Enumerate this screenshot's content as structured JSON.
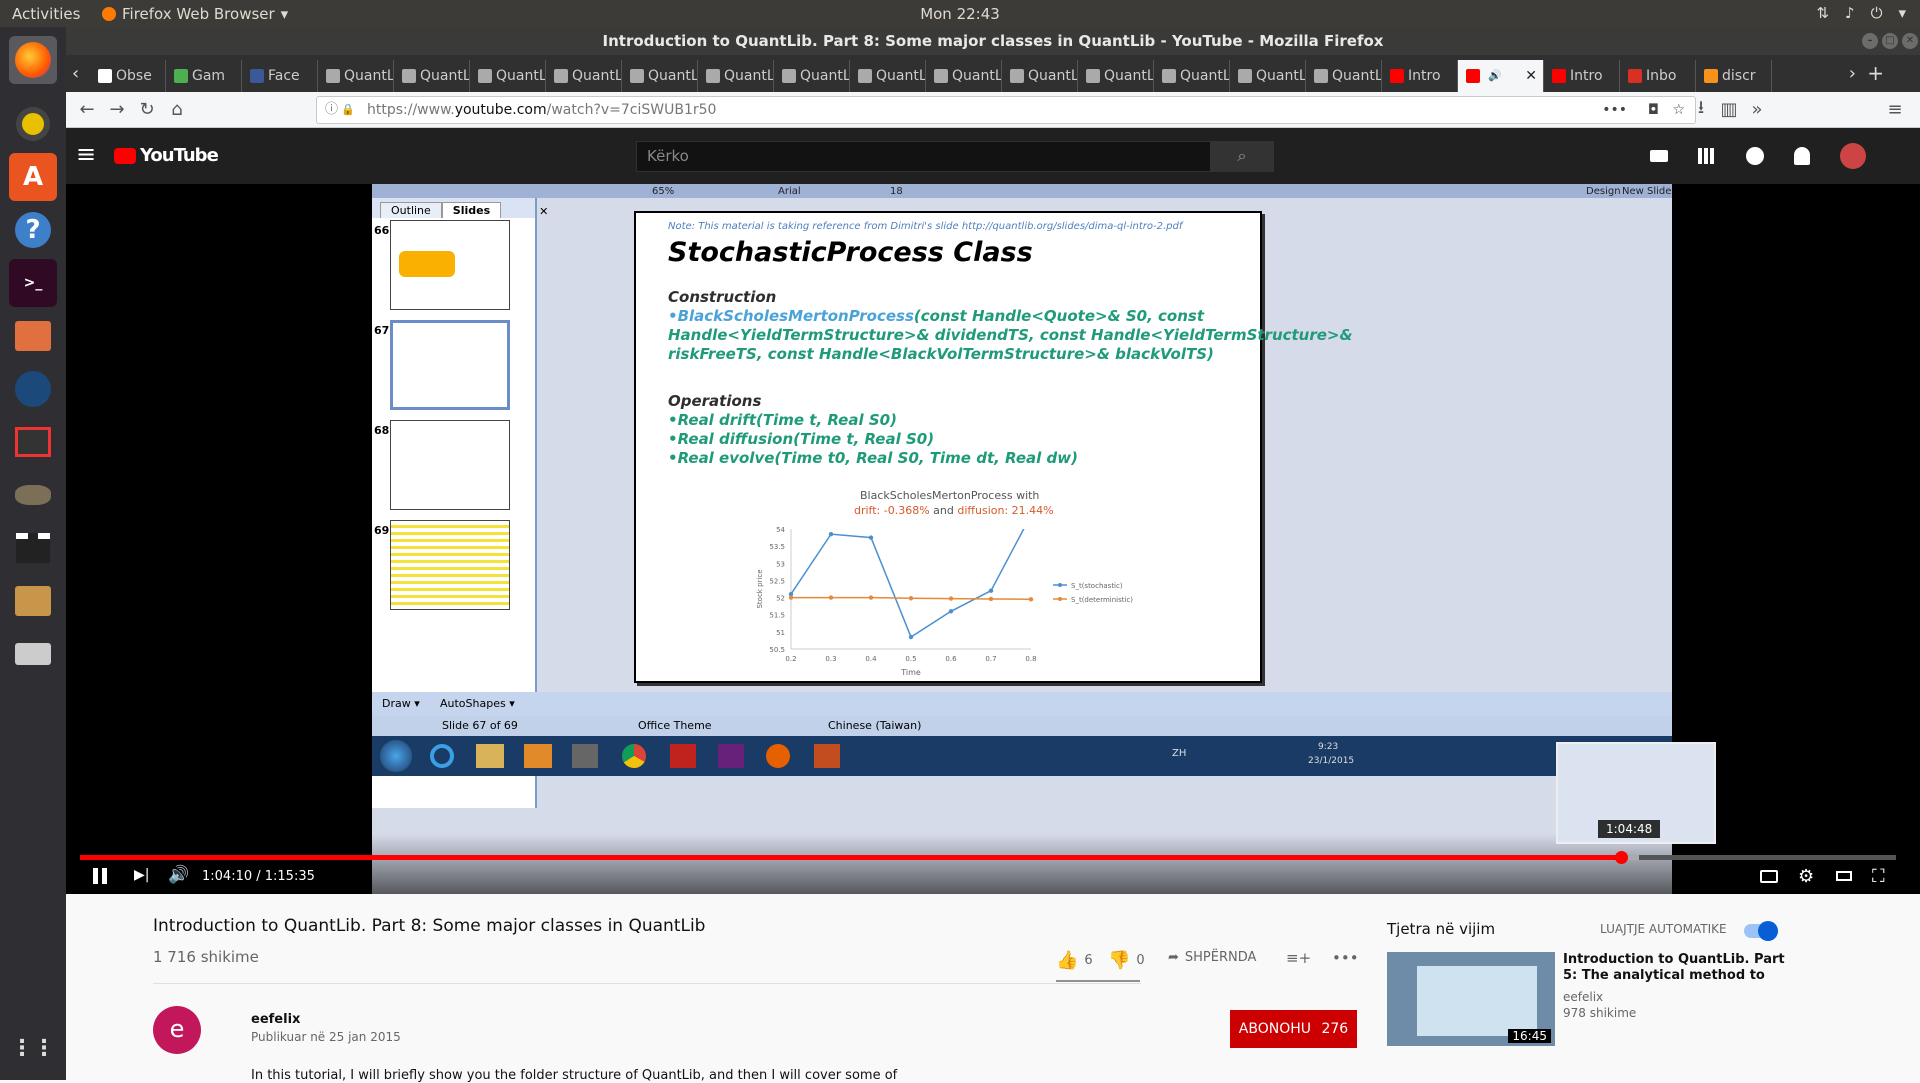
{
  "topbar": {
    "activities": "Activities",
    "app": "Firefox Web Browser",
    "app_caret": "▾",
    "clock": "Mon 22:43",
    "tray_network": "⇅",
    "tray_volume": "♪",
    "tray_power": "⏻",
    "tray_caret": "▾"
  },
  "window": {
    "title": "Introduction to QuantLib. Part 8: Some major classes in QuantLib - YouTube - Mozilla Firefox"
  },
  "tabs": [
    {
      "label": "Obse",
      "icon": "wikipedia",
      "color": "#ffffff"
    },
    {
      "label": "Gam",
      "icon": "game",
      "color": "#4caf50"
    },
    {
      "label": "Face",
      "icon": "facebook",
      "color": "#3b5998"
    },
    {
      "label": "QuantLi",
      "icon": "page",
      "color": "#aaaaaa"
    },
    {
      "label": "QuantLi",
      "icon": "page",
      "color": "#aaaaaa"
    },
    {
      "label": "QuantLi",
      "icon": "page",
      "color": "#aaaaaa"
    },
    {
      "label": "QuantLi",
      "icon": "page",
      "color": "#aaaaaa"
    },
    {
      "label": "QuantLi",
      "icon": "page",
      "color": "#aaaaaa"
    },
    {
      "label": "QuantLi",
      "icon": "page",
      "color": "#aaaaaa"
    },
    {
      "label": "QuantLi",
      "icon": "page",
      "color": "#aaaaaa"
    },
    {
      "label": "QuantLi",
      "icon": "page",
      "color": "#aaaaaa"
    },
    {
      "label": "QuantLi",
      "icon": "page",
      "color": "#aaaaaa"
    },
    {
      "label": "QuantLi",
      "icon": "page",
      "color": "#aaaaaa"
    },
    {
      "label": "QuantLi",
      "icon": "page",
      "color": "#aaaaaa"
    },
    {
      "label": "QuantLi",
      "icon": "page",
      "color": "#aaaaaa"
    },
    {
      "label": "QuantLi",
      "icon": "page",
      "color": "#aaaaaa"
    },
    {
      "label": "QuantLi",
      "icon": "page",
      "color": "#aaaaaa"
    },
    {
      "label": "Intro",
      "icon": "youtube",
      "color": "#ff0000"
    },
    {
      "label": "",
      "icon": "youtube",
      "color": "#ff0000",
      "active": true
    },
    {
      "label": "Intro",
      "icon": "youtube",
      "color": "#ff0000"
    },
    {
      "label": "Inbo",
      "icon": "gmail",
      "color": "#d93025"
    },
    {
      "label": "discr",
      "icon": "bitcoin",
      "color": "#f7931a"
    }
  ],
  "nav": {
    "url_prefix": "https://www.",
    "url_domain": "youtube.com",
    "url_path": "/watch?v=7ciSWUB1r50",
    "back": "←",
    "forward": "→",
    "reload": "↻",
    "home": "⌂",
    "more": "•••",
    "pocket": "◘",
    "star": "☆",
    "download": "⭳",
    "library": "▥",
    "overflow": "»",
    "menu": "≡",
    "newtab": "+",
    "scroll_left": "‹",
    "scroll_right": "›",
    "tab_close": "✕",
    "tab_speaker": "🔊",
    "info": "ⓘ",
    "lock": "🔒"
  },
  "youtube": {
    "logo": "YouTube",
    "search_placeholder": "Kërko",
    "search_icon": "⌕",
    "menu_icon": "≡"
  },
  "ppt": {
    "tab_outline": "Outline",
    "tab_slides": "Slides",
    "pane_close": "✕",
    "slide_nums": [
      "66",
      "67",
      "68",
      "69"
    ],
    "status_slide": "Slide 67 of 69",
    "status_theme": "Office Theme",
    "status_lang": "Chinese (Taiwan)",
    "draw": "Draw ▾",
    "autoshapes": "AutoShapes ▾",
    "design": "Design",
    "new_slide": "New Slide",
    "font": "Arial",
    "size": "18",
    "zoom": "65%",
    "clock_time": "9:23",
    "clock_date": "23/1/2015",
    "lang": "ZH"
  },
  "slide": {
    "note": "Note: This material is taking reference from Dimitri's slide http://quantlib.org/slides/dima-ql-intro-2.pdf",
    "title": "StochasticProcess Class",
    "construction": "Construction",
    "l1a": "•BlackScholesMertonProcess",
    "l1b": "(const Handle<Quote>& S0, const",
    "l2": "Handle<YieldTermStructure>& dividendTS, const Handle<YieldTermStructure>&",
    "l3": "riskFreeTS, const Handle<BlackVolTermStructure>& blackVolTS)",
    "operations": "Operations",
    "op1": "•Real drift(Time t, Real S0)",
    "op2": "•Real diffusion(Time t, Real S0)",
    "op3": "•Real evolve(Time t0, Real S0, Time dt, Real dw)"
  },
  "chart_data": {
    "type": "line",
    "title": "BlackScholesMertonProcess with",
    "subtitle_drift": "drift: -0.368%",
    "subtitle_and": "and",
    "subtitle_diffusion": "diffusion: 21.44%",
    "xlabel": "Time",
    "ylabel": "Stock price",
    "xlim": [
      0.2,
      0.8
    ],
    "ylim": [
      50.5,
      54
    ],
    "x_ticks": [
      "0.2",
      "0.3",
      "0.4",
      "0.5",
      "0.6",
      "0.7",
      "0.8"
    ],
    "y_ticks": [
      "50.5",
      "51",
      "51.5",
      "52",
      "52.5",
      "53",
      "53.5",
      "54"
    ],
    "series": [
      {
        "name": "S_t(stochastic)",
        "color": "#4a8fcf",
        "x": [
          0.2,
          0.3,
          0.4,
          0.5,
          0.6,
          0.7,
          0.8
        ],
        "y": [
          52.1,
          53.85,
          53.75,
          50.85,
          51.6,
          52.2,
          54.4
        ]
      },
      {
        "name": "S_t(deterministic)",
        "color": "#e58a3a",
        "x": [
          0.2,
          0.3,
          0.4,
          0.5,
          0.6,
          0.7,
          0.8
        ],
        "y": [
          52,
          52,
          52,
          51.98,
          51.97,
          51.96,
          51.95
        ]
      }
    ]
  },
  "player": {
    "time": "1:04:10 / 1:15:35",
    "preview_time": "1:04:48",
    "progress": 0.8487,
    "buffered": 0.8587
  },
  "video": {
    "title": "Introduction to QuantLib. Part 8: Some major classes in QuantLib",
    "views": "1 716 shikime",
    "likes": "6",
    "dislikes": "0",
    "share": "SHPËRNDA",
    "more": "•••",
    "add": "≡+"
  },
  "channel": {
    "avatar_letter": "e",
    "name": "eefelix",
    "published": "Publikuar në 25 jan 2015",
    "subscribe": "ABONOHU",
    "subscribers": "276",
    "description": "In this tutorial, I will briefly show you the folder structure of QuantLib, and then I will cover some of"
  },
  "sidebar": {
    "up_next": "Tjetra në vijim",
    "autoplay": "LUAJTJE AUTOMATIKE",
    "next_title_l1": "Introduction to QuantLib. Part",
    "next_title_l2": "5: The analytical method to",
    "next_channel": "eefelix",
    "next_views": "978 shikime",
    "next_duration": "16:45"
  }
}
